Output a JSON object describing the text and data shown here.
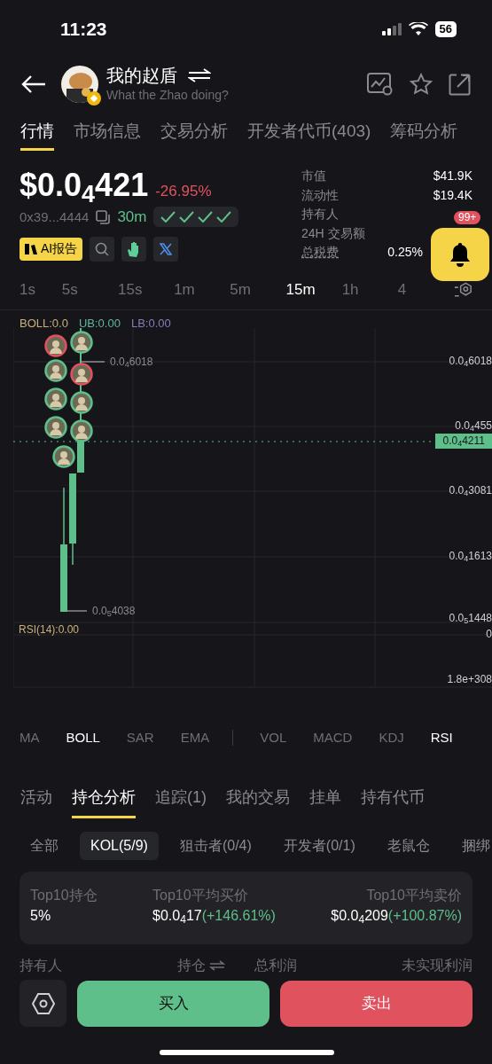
{
  "status_bar": {
    "time": "11:23",
    "battery": "56"
  },
  "header": {
    "title": "我的赵盾",
    "subtitle": "What the Zhao doing?"
  },
  "main_tabs": [
    {
      "label": "行情",
      "selected": true
    },
    {
      "label": "市场信息",
      "selected": false
    },
    {
      "label": "交易分析",
      "selected": false
    },
    {
      "label": "开发者代币(403)",
      "selected": false
    },
    {
      "label": "筹码分析",
      "selected": false
    }
  ],
  "price": {
    "value": "$0.0$_{4}$421",
    "change": "-26.95%",
    "address": "0x39...4444",
    "age": "30m"
  },
  "security_checks": [
    {
      "passed": true
    },
    {
      "passed": true
    },
    {
      "passed": true
    },
    {
      "passed": true
    }
  ],
  "ai_report": "AI报告",
  "stats": [
    {
      "label": "市值",
      "value": "$41.9K"
    },
    {
      "label": "流动性",
      "value": "$19.4K"
    },
    {
      "label": "持有人"
    },
    {
      "label": "24H 交易额"
    },
    {
      "label": "总税费",
      "value": "0.25%"
    }
  ],
  "notifications": {
    "badge": "99+"
  },
  "timeframes": [
    {
      "label": "1s",
      "selected": false
    },
    {
      "label": "5s",
      "selected": false
    },
    {
      "label": "15s",
      "selected": false
    },
    {
      "label": "1m",
      "selected": false
    },
    {
      "label": "5m",
      "selected": false
    },
    {
      "label": "15m",
      "selected": true
    },
    {
      "label": "1h",
      "selected": false
    },
    {
      "label": "4",
      "selected": false
    }
  ],
  "chart": {
    "legend": [
      {
        "label": "UB:0.00",
        "color": "#5fb89a"
      },
      {
        "label": "LB:0.00",
        "color": "#8b7bb8"
      }
    ],
    "legend_main": "BOLL:0.0",
    "high_label": "0.0$_{4}$6018",
    "low_label": "0.0$_{5}$4038",
    "rsi_label": "RSI(14):0.00",
    "y_labels": [
      {
        "text": "0.0$_{4}$6018",
        "kind": "plain"
      },
      {
        "text": "0.0$_{4}$455",
        "kind": "plain"
      },
      {
        "text": "0.0$_{4}$4211",
        "kind": "current"
      },
      {
        "text": "0.0$_{4}$3081",
        "kind": "plain"
      },
      {
        "text": "0.0$_{4}$1613",
        "kind": "plain"
      },
      {
        "text": "0.0$_{5}$1448",
        "kind": "plain"
      },
      {
        "text": "0",
        "kind": "plain"
      },
      {
        "text": "1.8e+308",
        "kind": "plain"
      }
    ],
    "markers": [
      {
        "color": "#e0525e"
      },
      {
        "color": "#5fbf8a"
      },
      {
        "color": "#5fbf8a"
      },
      {
        "color": "#e0525e"
      },
      {
        "color": "#5fbf8a"
      },
      {
        "color": "#5fbf8a"
      },
      {
        "color": "#5fbf8a"
      },
      {
        "color": "#5fbf8a"
      },
      {
        "color": "#5fbf8a"
      }
    ]
  },
  "indicators_main": [
    {
      "label": "MA",
      "selected": false
    },
    {
      "label": "BOLL",
      "selected": true
    },
    {
      "label": "SAR",
      "selected": false
    },
    {
      "label": "EMA",
      "selected": false
    }
  ],
  "indicators_sub": [
    {
      "label": "VOL",
      "selected": false
    },
    {
      "label": "MACD",
      "selected": false
    },
    {
      "label": "KDJ",
      "selected": false
    },
    {
      "label": "RSI",
      "selected": true
    }
  ],
  "bottom_tabs": [
    {
      "label": "活动",
      "selected": false
    },
    {
      "label": "持仓分析",
      "selected": true
    },
    {
      "label": "追踪(1)",
      "selected": false
    },
    {
      "label": "我的交易",
      "selected": false
    },
    {
      "label": "挂单",
      "selected": false
    },
    {
      "label": "持有代币",
      "selected": false
    }
  ],
  "filters": [
    {
      "label": "全部",
      "selected": false
    },
    {
      "label": "KOL(5/9)",
      "selected": true
    },
    {
      "label": "狙击者(0/4)",
      "selected": false
    },
    {
      "label": "开发者(0/1)",
      "selected": false
    },
    {
      "label": "老鼠仓",
      "selected": false
    },
    {
      "label": "捆绑",
      "selected": false
    }
  ],
  "summary": [
    {
      "label": "Top10持仓",
      "value": "5%"
    },
    {
      "label": "Top10平均买价",
      "value": "$0.0$_{4}$17",
      "change": "(+146.61%)"
    },
    {
      "label": "Top10平均卖价",
      "value": "$0.0$_{4}$209",
      "change": "(+100.87%)"
    }
  ],
  "columns": [
    "持有人",
    "持仓",
    "总利润",
    "未实现利润"
  ],
  "actions": {
    "buy": "买入",
    "sell": "卖出"
  }
}
